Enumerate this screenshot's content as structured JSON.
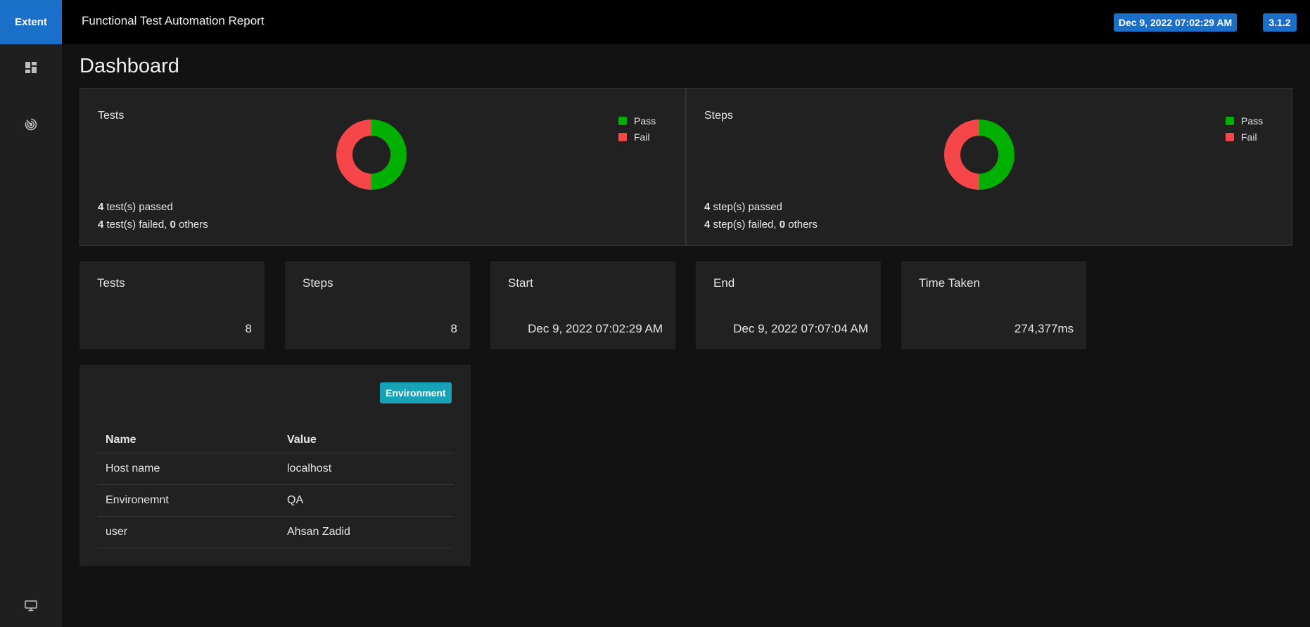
{
  "app": {
    "brand": "Extent",
    "report_title": "Functional Test Automation Report",
    "timestamp_badge": "Dec 9, 2022 07:02:29 AM",
    "version_badge": "3.1.2"
  },
  "sidebar": {
    "items": [
      {
        "icon": "dashboard-icon"
      },
      {
        "icon": "radar-icon"
      },
      {
        "icon": "monitor-icon"
      }
    ]
  },
  "page": {
    "title": "Dashboard"
  },
  "colors": {
    "pass": "#00af00",
    "fail": "#f7464a",
    "accent": "#1a6fc9",
    "env_badge": "#17a2b8"
  },
  "tests_card": {
    "title": "Tests",
    "legend": [
      "Pass",
      "Fail"
    ],
    "passed_count": "4",
    "passed_text": " test(s) passed",
    "failed_count": "4",
    "failed_text": " test(s) failed, ",
    "others_count": "0",
    "others_text": " others"
  },
  "steps_card": {
    "title": "Steps",
    "legend": [
      "Pass",
      "Fail"
    ],
    "passed_count": "4",
    "passed_text": " step(s) passed",
    "failed_count": "4",
    "failed_text": " step(s) failed, ",
    "others_count": "0",
    "others_text": " others"
  },
  "chart_data": [
    {
      "type": "pie",
      "title": "Tests",
      "categories": [
        "Pass",
        "Fail"
      ],
      "values": [
        4,
        4
      ],
      "colors": [
        "#00af00",
        "#f7464a"
      ],
      "legend": "top-right"
    },
    {
      "type": "pie",
      "title": "Steps",
      "categories": [
        "Pass",
        "Fail"
      ],
      "values": [
        4,
        4
      ],
      "colors": [
        "#00af00",
        "#f7464a"
      ],
      "legend": "top-right"
    }
  ],
  "tiles": [
    {
      "label": "Tests",
      "value": "8"
    },
    {
      "label": "Steps",
      "value": "8"
    },
    {
      "label": "Start",
      "value": "Dec 9, 2022 07:02:29 AM"
    },
    {
      "label": "End",
      "value": "Dec 9, 2022 07:07:04 AM"
    },
    {
      "label": "Time Taken",
      "value": "274,377ms"
    }
  ],
  "environment": {
    "badge": "Environment",
    "headers": [
      "Name",
      "Value"
    ],
    "rows": [
      {
        "name": "Host name",
        "value": "localhost"
      },
      {
        "name": "Environemnt",
        "value": "QA"
      },
      {
        "name": "user",
        "value": "Ahsan Zadid"
      }
    ]
  }
}
